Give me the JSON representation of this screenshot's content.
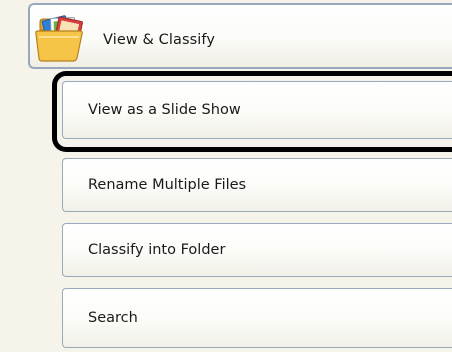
{
  "header": {
    "title": "View & Classify",
    "icon": "folder-with-pictures-icon"
  },
  "items": [
    {
      "label": "View as a Slide Show",
      "highlighted": true
    },
    {
      "label": "Rename Multiple Files"
    },
    {
      "label": "Classify into Folder"
    },
    {
      "label": "Search"
    }
  ],
  "colors": {
    "panel_bg": "#f5f3ea",
    "border": "#9aa9bd",
    "highlight": "#000000",
    "text": "#1a1a1a"
  }
}
